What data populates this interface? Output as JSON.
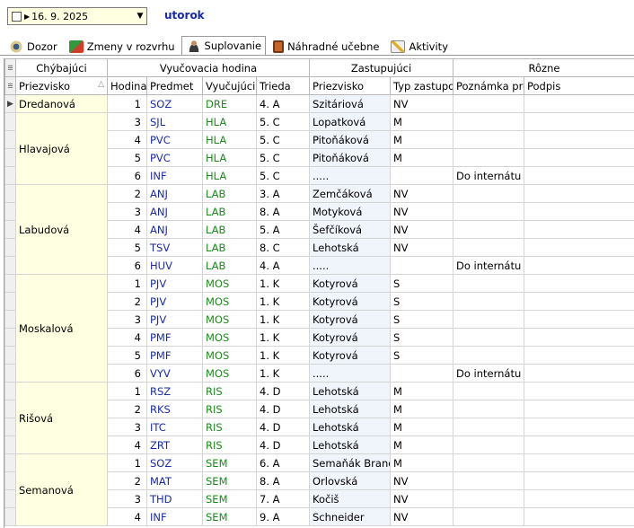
{
  "toolbar": {
    "date": "16. 9. 2025",
    "day": "utorok"
  },
  "tabs": [
    {
      "label": "Dozor",
      "icon": "eye-icon"
    },
    {
      "label": "Zmeny v rozvrhu",
      "icon": "swap-icon"
    },
    {
      "label": "Suplovanie",
      "icon": "person-icon"
    },
    {
      "label": "Náhradné učebne",
      "icon": "door-icon"
    },
    {
      "label": "Aktivity",
      "icon": "edit-icon"
    }
  ],
  "groups": [
    "Chýbajúci",
    "Vyučovacia hodina",
    "Zastupujúci",
    "Rôzne"
  ],
  "columns": [
    "Priezvisko",
    "Hodina",
    "Predmet",
    "Vyučujúci",
    "Trieda",
    "Priezvisko",
    "Typ zastupovania",
    "Poznámka pre",
    "Podpis"
  ],
  "rows": [
    {
      "missing": "Dredanová",
      "span": 1,
      "hour": "1",
      "subject": "SOZ",
      "teacher": "DRE",
      "cls": "4. A",
      "sub": "Szitáriová",
      "type": "NV",
      "note": ""
    },
    {
      "missing": "Hlavajová",
      "span": 4,
      "hour": "3",
      "subject": "SJL",
      "teacher": "HLA",
      "cls": "5. C",
      "sub": "Lopatková",
      "type": "M",
      "note": ""
    },
    {
      "hour": "4",
      "subject": "PVC",
      "teacher": "HLA",
      "cls": "5. C",
      "sub": "Pitoňáková",
      "type": "M",
      "note": ""
    },
    {
      "hour": "5",
      "subject": "PVC",
      "teacher": "HLA",
      "cls": "5. C",
      "sub": "Pitoňáková",
      "type": "M",
      "note": ""
    },
    {
      "hour": "6",
      "subject": "INF",
      "teacher": "HLA",
      "cls": "5. C",
      "sub": ".....",
      "type": "",
      "note": "Do internátu"
    },
    {
      "missing": "Labudová",
      "span": 5,
      "hour": "2",
      "subject": "ANJ",
      "teacher": "LAB",
      "cls": "3. A",
      "sub": "Zemčáková",
      "type": "NV",
      "note": ""
    },
    {
      "hour": "3",
      "subject": "ANJ",
      "teacher": "LAB",
      "cls": "8. A",
      "sub": "Motyková",
      "type": "NV",
      "note": ""
    },
    {
      "hour": "4",
      "subject": "ANJ",
      "teacher": "LAB",
      "cls": "5. A",
      "sub": "Šefčíková",
      "type": "NV",
      "note": ""
    },
    {
      "hour": "5",
      "subject": "TSV",
      "teacher": "LAB",
      "cls": "8. C",
      "sub": "Lehotská",
      "type": "NV",
      "note": ""
    },
    {
      "hour": "6",
      "subject": "HUV",
      "teacher": "LAB",
      "cls": "4. A",
      "sub": ".....",
      "type": "",
      "note": "Do internátu"
    },
    {
      "missing": "Moskalová",
      "span": 6,
      "hour": "1",
      "subject": "PJV",
      "teacher": "MOS",
      "cls": "1. K",
      "sub": "Kotyrová",
      "type": "S",
      "note": ""
    },
    {
      "hour": "2",
      "subject": "PJV",
      "teacher": "MOS",
      "cls": "1. K",
      "sub": "Kotyrová",
      "type": "S",
      "note": ""
    },
    {
      "hour": "3",
      "subject": "PJV",
      "teacher": "MOS",
      "cls": "1. K",
      "sub": "Kotyrová",
      "type": "S",
      "note": ""
    },
    {
      "hour": "4",
      "subject": "PMF",
      "teacher": "MOS",
      "cls": "1. K",
      "sub": "Kotyrová",
      "type": "S",
      "note": ""
    },
    {
      "hour": "5",
      "subject": "PMF",
      "teacher": "MOS",
      "cls": "1. K",
      "sub": "Kotyrová",
      "type": "S",
      "note": ""
    },
    {
      "hour": "6",
      "subject": "VYV",
      "teacher": "MOS",
      "cls": "1. K",
      "sub": ".....",
      "type": "",
      "note": "Do internátu"
    },
    {
      "missing": "Rišová",
      "span": 4,
      "hour": "1",
      "subject": "RSZ",
      "teacher": "RIS",
      "cls": "4. D",
      "sub": "Lehotská",
      "type": "M",
      "note": ""
    },
    {
      "hour": "2",
      "subject": "RKS",
      "teacher": "RIS",
      "cls": "4. D",
      "sub": "Lehotská",
      "type": "M",
      "note": ""
    },
    {
      "hour": "3",
      "subject": "ITC",
      "teacher": "RIS",
      "cls": "4. D",
      "sub": "Lehotská",
      "type": "M",
      "note": ""
    },
    {
      "hour": "4",
      "subject": "ZRT",
      "teacher": "RIS",
      "cls": "4. D",
      "sub": "Lehotská",
      "type": "M",
      "note": ""
    },
    {
      "missing": "Semanová",
      "span": 5,
      "hour": "1",
      "subject": "SOZ",
      "teacher": "SEM",
      "cls": "6. A",
      "sub": "Semaňák Brando",
      "type": "M",
      "note": ""
    },
    {
      "hour": "2",
      "subject": "MAT",
      "teacher": "SEM",
      "cls": "8. A",
      "sub": "Orlovská",
      "type": "NV",
      "note": ""
    },
    {
      "hour": "3",
      "subject": "THD",
      "teacher": "SEM",
      "cls": "7. A",
      "sub": "Kočiš",
      "type": "NV",
      "note": ""
    },
    {
      "hour": "4",
      "subject": "INF",
      "teacher": "SEM",
      "cls": "9. A",
      "sub": "Schneider",
      "type": "NV",
      "note": ""
    }
  ]
}
